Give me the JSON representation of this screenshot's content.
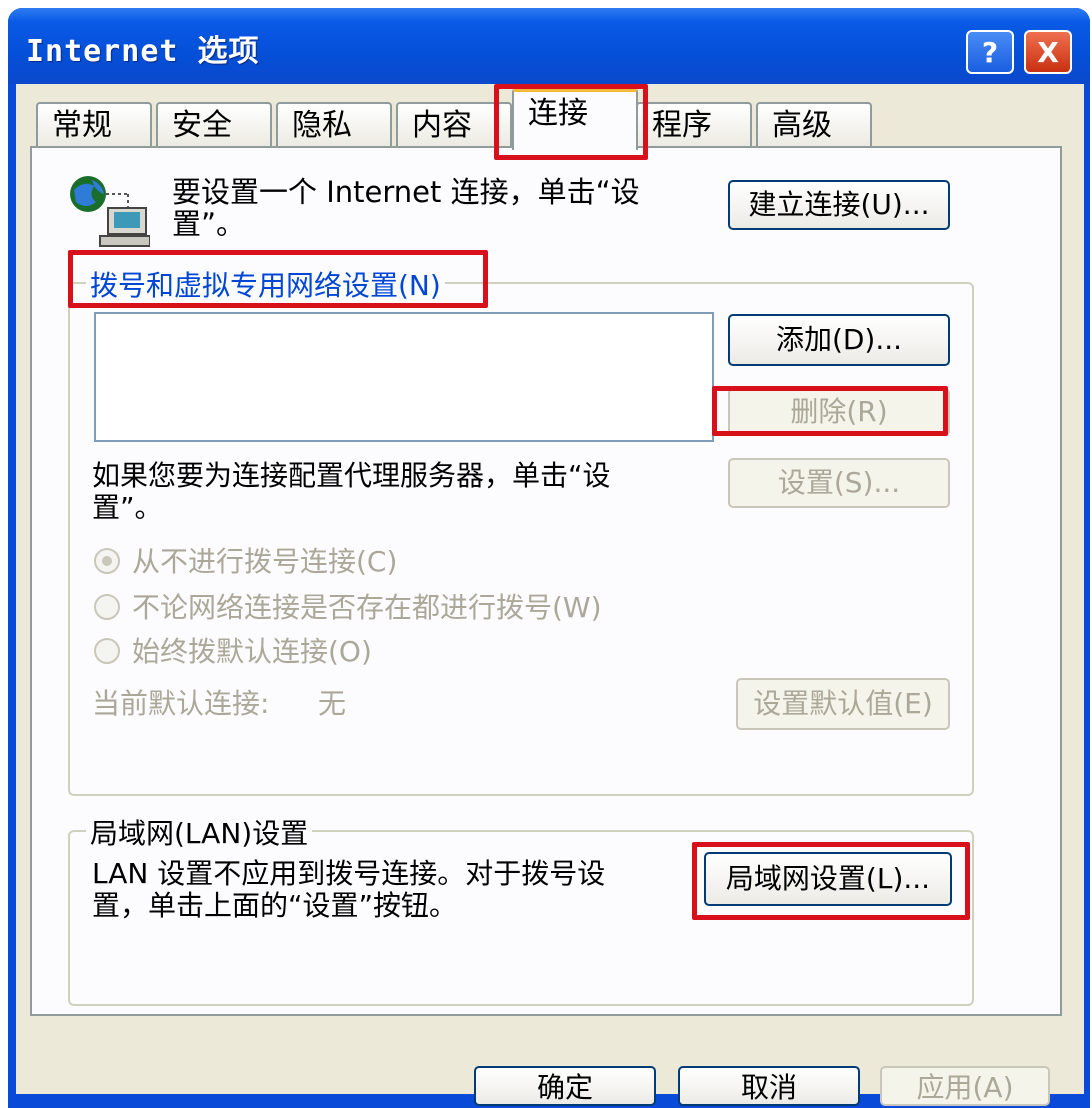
{
  "window": {
    "title": "Internet 选项",
    "help_glyph": "?",
    "close_glyph": "X"
  },
  "tabs": [
    {
      "label": "常规"
    },
    {
      "label": "安全"
    },
    {
      "label": "隐私"
    },
    {
      "label": "内容"
    },
    {
      "label": "连接",
      "active": true
    },
    {
      "label": "程序"
    },
    {
      "label": "高级"
    }
  ],
  "setup": {
    "text_line1": "要设置一个 Internet 连接，单击“设",
    "text_line2": "置”。",
    "button": "建立连接(U)..."
  },
  "dialup": {
    "group_title": "拨号和虚拟专用网络设置(N)",
    "add_button": "添加(D)...",
    "remove_button": "删除(R)",
    "proxy_text_line1": "如果您要为连接配置代理服务器，单击“设",
    "proxy_text_line2": "置”。",
    "settings_button": "设置(S)...",
    "options": [
      {
        "label": "从不进行拨号连接(C)",
        "selected": true
      },
      {
        "label": "不论网络连接是否存在都进行拨号(W)",
        "selected": false
      },
      {
        "label": "始终拨默认连接(O)",
        "selected": false
      }
    ],
    "default_label": "当前默认连接:",
    "default_value": "无",
    "set_default_button": "设置默认值(E)"
  },
  "lan": {
    "group_title": "局域网(LAN)设置",
    "text_line1": "LAN 设置不应用到拨号连接。对于拨号设",
    "text_line2": "置，单击上面的“设置”按钮。",
    "button": "局域网设置(L)..."
  },
  "footer": {
    "ok": "确定",
    "cancel": "取消",
    "apply": "应用(A)"
  },
  "colors": {
    "titlebar": "#0a5ae6",
    "highlight": "#d8101c",
    "dialog_bg": "#ece9d8"
  }
}
